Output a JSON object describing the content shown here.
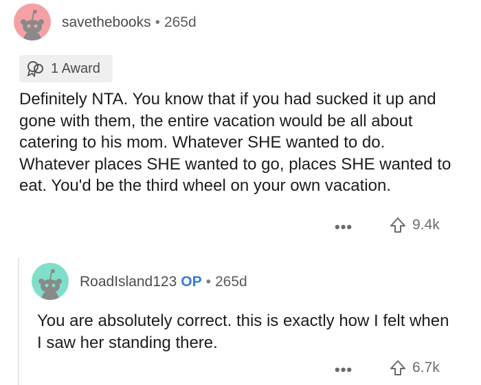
{
  "comment": {
    "username": "savethebooks",
    "age": "265d",
    "award": "1 Award",
    "text": "Definitely NTA. You know that if you had sucked it up and gone with them, the entire vacation would be all about catering to his mom. Whatever SHE wanted to do. Whatever places SHE wanted to go, places SHE wanted to eat. You'd be the third wheel on your own vacation.",
    "more": "•••",
    "votes": "9.4k",
    "avatar_color": "#f4a1a6"
  },
  "reply": {
    "username": "RoadIsland123",
    "op_label": "OP",
    "age": "265d",
    "text": "You are absolutely correct. this is exactly how I felt when I saw her standing there.",
    "more": "•••",
    "votes": "6.7k",
    "avatar_color": "#7fdfc9"
  },
  "colors": {
    "op": "#3a7bd5",
    "thread_line": "#e6e6e6",
    "award_bg": "#efefef"
  }
}
